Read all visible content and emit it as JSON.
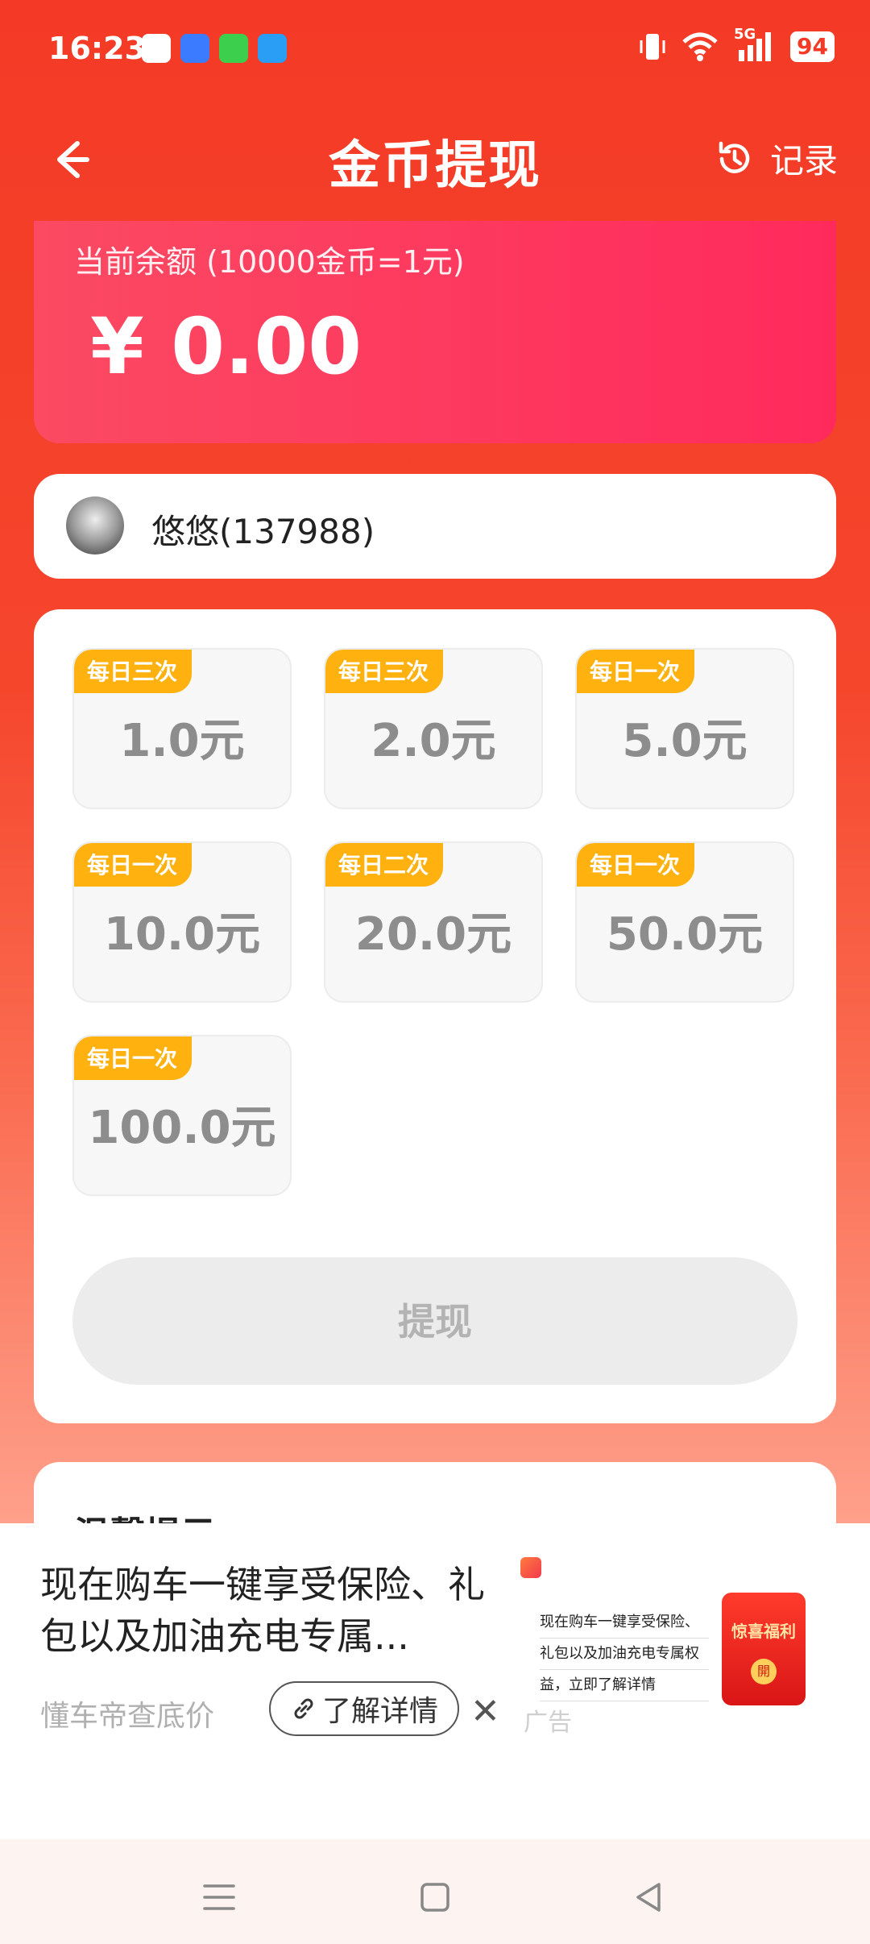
{
  "status_bar": {
    "time": "16:23",
    "notification_icons": [
      "search-app-icon",
      "browser-app-icon",
      "phone-app-icon",
      "qq-app-icon"
    ],
    "network": "5G",
    "battery": "94"
  },
  "header": {
    "title": "金币提现",
    "records_label": "记录"
  },
  "balance": {
    "label": "当前余额 (10000金币=1元)",
    "amount": "¥ 0.00"
  },
  "user": {
    "name": "悠悠(137988)"
  },
  "options": [
    {
      "badge": "每日三次",
      "value": "1.0元"
    },
    {
      "badge": "每日三次",
      "value": "2.0元"
    },
    {
      "badge": "每日一次",
      "value": "5.0元"
    },
    {
      "badge": "每日一次",
      "value": "10.0元"
    },
    {
      "badge": "每日二次",
      "value": "20.0元"
    },
    {
      "badge": "每日一次",
      "value": "50.0元"
    },
    {
      "badge": "每日一次",
      "value": "100.0元"
    }
  ],
  "withdraw_button": "提现",
  "tips": {
    "title": "温馨提示"
  },
  "ad": {
    "text": "现在购车一键享受保险、礼包以及加油充电专属...",
    "source": "懂车帝查底价",
    "detail_label": "了解详情",
    "label": "广告",
    "thumb_lines": [
      "现在购车一键享受保险、",
      "礼包以及加油充电专属权",
      "益，立即了解详情"
    ],
    "thumb_redpacket": "惊喜福利",
    "thumb_redpacket_btn": "開"
  },
  "colors": {
    "header_red": "#f43a26",
    "balance_card": "#ff2a5c",
    "badge_yellow": "#ffb20f",
    "option_text": "#8d8d8d"
  }
}
